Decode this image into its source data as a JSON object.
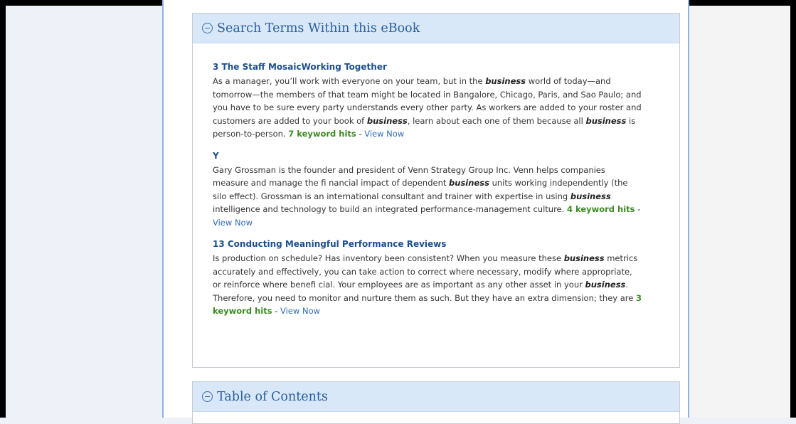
{
  "search_panel": {
    "title": "Search Terms Within this eBook",
    "results": [
      {
        "title": "3 The Staff MosaicWorking Together",
        "segments": [
          "As a manager, you’ll work with everyone on your team, but in the ",
          "business",
          " world of today—and tomorrow—the members of that team might be located in Bangalore, Chicago, Paris, and Sao Paulo; and you have to be sure every party understands every other party. As workers are added to your roster and customers are added to your book of ",
          "business",
          ", learn about each one of them because all ",
          "business",
          " is person-to-person. "
        ],
        "hits": "7 keyword hits",
        "separator": " - ",
        "link": "View Now"
      },
      {
        "title": "Y",
        "segments": [
          "Gary Grossman is the founder and president of Venn Strategy Group Inc. Venn helps companies measure and manage the fi nancial impact of dependent ",
          "business",
          " units working independently (the silo effect). Grossman is an international consultant and trainer with expertise in using ",
          "business",
          " intelligence and technology to build an integrated performance-management culture. "
        ],
        "hits": "4 keyword hits",
        "separator": " - ",
        "link": "View Now"
      },
      {
        "title": "13 Conducting Meaningful Performance Reviews",
        "segments": [
          "Is production on schedule? Has inventory been consistent? When you measure these ",
          "business",
          " metrics accurately and effectively, you can take action to correct where necessary, modify where appropriate, or reinforce where benefi cial. Your employees are as important as any other asset in your ",
          "business",
          ". Therefore, you need to monitor and nurture them as such. But they have an extra dimension; they are "
        ],
        "hits": "3 keyword hits",
        "separator": " - ",
        "link": "View Now"
      }
    ]
  },
  "toc_panel": {
    "title": "Table of Contents"
  }
}
